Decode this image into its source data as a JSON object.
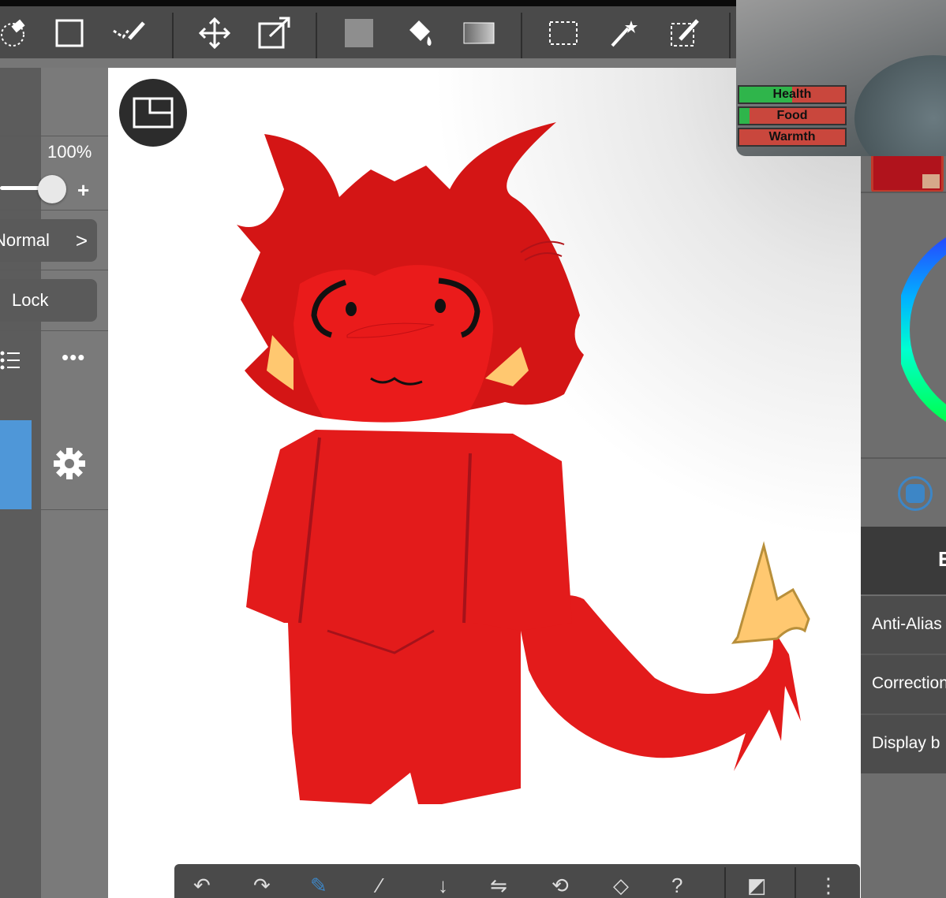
{
  "layer_panel": {
    "opacity": "100%",
    "opacity_value": 1.0,
    "slider_plus": "+",
    "blend_mode": "Normal",
    "blend_chevron": ">",
    "lock_label": "Lock",
    "more_label": "•••"
  },
  "right_panel": {
    "section_letter": "E",
    "items": [
      "Anti-Alias",
      "Correction",
      "Display b"
    ]
  },
  "game_overlay": {
    "stats": [
      {
        "label": "Health",
        "value": 0.5
      },
      {
        "label": "Food",
        "value": 0.1
      },
      {
        "label": "Warmth",
        "value": 0.0
      }
    ]
  },
  "colors": {
    "selected_layer": "#4f97d8",
    "primary_color": "#b0131c",
    "secondary_color": "#d6a88a",
    "character_red": "#e31b1b",
    "health_green": "#2fb54b"
  },
  "bottom_toolbar": {
    "help": "?"
  }
}
